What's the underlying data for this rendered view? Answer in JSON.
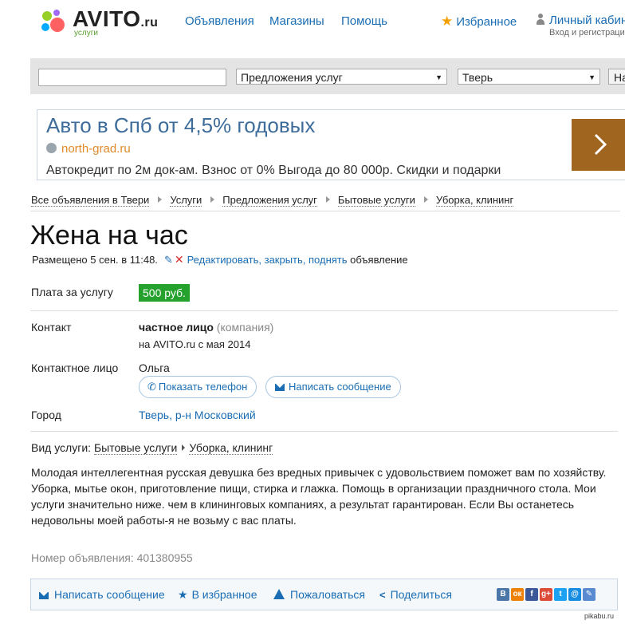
{
  "header": {
    "logo_text": "AVITO",
    "logo_ru": ".ru",
    "logo_sub": "услуги",
    "nav": [
      "Объявления",
      "Магазины",
      "Помощь"
    ],
    "favorites": "Избранное",
    "cabinet": "Личный кабинет",
    "cabinet_sub": "Вход и регистрация"
  },
  "search": {
    "query": "",
    "category": "Предложения услуг",
    "city": "Тверь",
    "button": "Найти"
  },
  "ad": {
    "title": "Авто в Спб от 4,5% годовых",
    "site": "north-grad.ru",
    "text": "Автокредит по 2м док-ам. Взнос от 0% Выгода до 80 000р. Скидки и подарки"
  },
  "breadcrumbs": [
    "Все объявления в Твери",
    "Услуги",
    "Предложения услуг",
    "Бытовые услуги",
    "Уборка, клининг"
  ],
  "listing": {
    "title": "Жена на час",
    "posted": "Размещено 5 сен. в 11:48.",
    "edit_link": "Редактировать, закрыть, поднять",
    "edit_suffix": "объявление",
    "price_label": "Плата за услугу",
    "price": "500 руб.",
    "contact_label": "Контакт",
    "contact_name": "частное лицо",
    "contact_type": "(компания)",
    "since": "на AVITO.ru с мая 2014",
    "person_label": "Контактное лицо",
    "person_name": "Ольга",
    "show_phone": "Показать телефон",
    "write_message": "Написать сообщение",
    "city_label": "Город",
    "city": "Тверь, р-н Московский",
    "service_kind_label": "Вид услуги:",
    "service_kind_1": "Бытовые услуги",
    "service_kind_2": "Уборка, клининг",
    "description": "Молодая интеллегентная русская девушка без вредных привычек с удовольствием поможет вам по хозяйству. Уборка, мытье окон, приготовление пищи, стирка и глажка. Помощь в организации праздничного стола. Мои услуги значительно ниже. чем в клининговых компаниях, а результат гарантирован. Если Вы останетесь недовольны моей работы-я не возьму с вас платы.",
    "number_label": "Номер объявления:",
    "number": "401380955"
  },
  "actions": {
    "write": "Написать сообщение",
    "favorite": "В избранное",
    "complain": "Пожаловаться",
    "share": "Поделиться"
  },
  "social": [
    {
      "label": "В",
      "color": "#4a76a8",
      "icon": "vk-icon"
    },
    {
      "label": "ок",
      "color": "#ee8208",
      "icon": "odnoklassniki-icon"
    },
    {
      "label": "f",
      "color": "#3b5998",
      "icon": "facebook-icon"
    },
    {
      "label": "g+",
      "color": "#dd4b39",
      "icon": "google-plus-icon"
    },
    {
      "label": "t",
      "color": "#1da1f2",
      "icon": "twitter-icon"
    },
    {
      "label": "@",
      "color": "#168de2",
      "icon": "mailru-icon"
    },
    {
      "label": "✎",
      "color": "#5a8bd0",
      "icon": "livejournal-icon"
    }
  ],
  "watermark": "pikabu.ru"
}
